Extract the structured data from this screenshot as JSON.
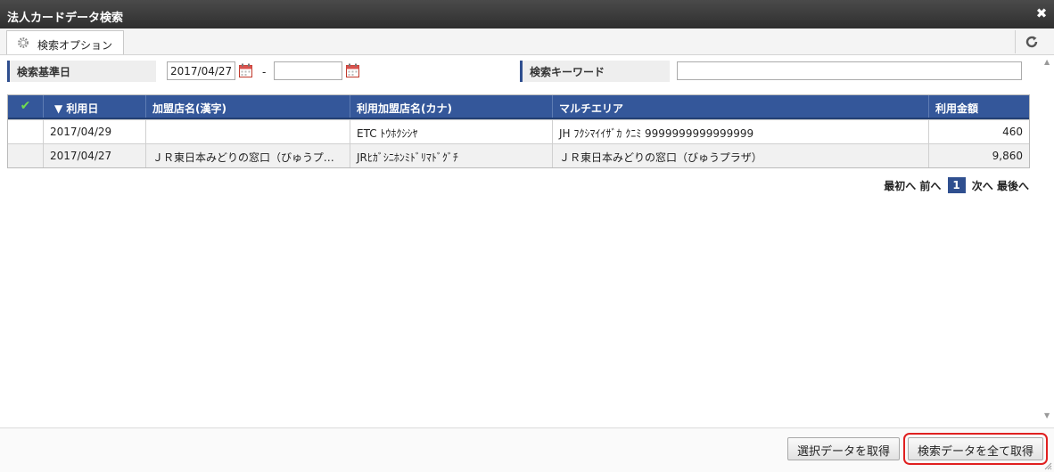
{
  "window": {
    "title": "法人カードデータ検索"
  },
  "toolbar": {
    "tab_label": "検索オプション"
  },
  "filters": {
    "base_date_label": "検索基準日",
    "date_from": "2017/04/27",
    "date_to": "",
    "separator": "-",
    "keyword_label": "検索キーワード",
    "keyword_value": ""
  },
  "table": {
    "columns": [
      "✔",
      "▼ 利用日",
      "加盟店名(漢字)",
      "利用加盟店名(カナ)",
      "マルチエリア",
      "利用金額"
    ],
    "rows": [
      {
        "date": "2017/04/29",
        "merchant_kanji": "",
        "merchant_kana": "ETC ﾄｳﾎｸｼｼﾔ",
        "multi_area": "JH ﾌｸｼﾏｲｲｻﾞｶ ｸﾆﾐ 9999999999999999",
        "amount": "460"
      },
      {
        "date": "2017/04/27",
        "merchant_kanji": "ＪＲ東日本みどりの窓口（びゅうプラ…",
        "merchant_kana": "JRﾋｶﾞｼﾆﾎﾝﾐﾄﾞﾘﾏﾄﾞｸﾞﾁ",
        "multi_area": "ＪＲ東日本みどりの窓口（びゅうプラザ）",
        "amount": "9,860"
      }
    ]
  },
  "pager": {
    "first": "最初へ",
    "prev": "前へ",
    "current": "1",
    "next": "次へ",
    "last": "最後へ"
  },
  "footer": {
    "get_selected": "選択データを取得",
    "get_all": "検索データを全て取得"
  },
  "icons": {
    "close": "close-icon",
    "gear": "gear-icon",
    "refresh": "refresh-icon",
    "calendar": "calendar-icon",
    "check": "check-icon"
  },
  "colors": {
    "header_bg": "#34579a",
    "titlebar": "#3a3a3a",
    "highlight": "#e02020"
  }
}
